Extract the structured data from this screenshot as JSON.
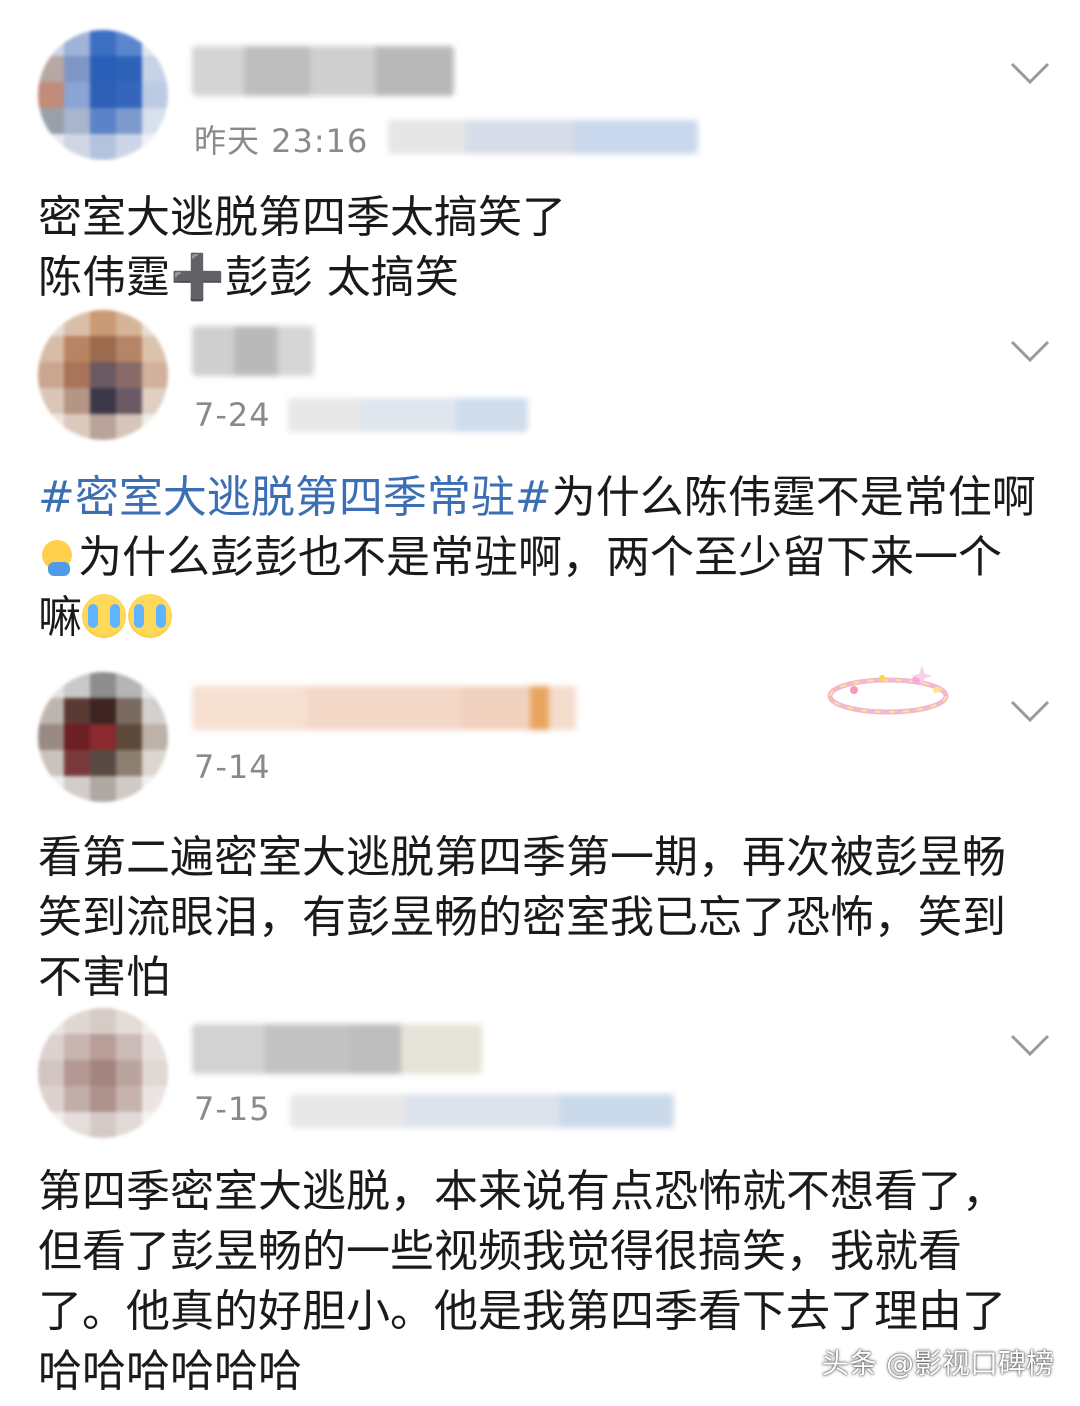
{
  "comments": [
    {
      "time": "昨天 23:16",
      "lines": [
        "密室大逃脱第四季太搞笑了",
        "陈伟霆",
        "彭彭 太搞笑"
      ],
      "plus_glyph": "➕"
    },
    {
      "time": "7-24",
      "hashtag": "#密室大逃脱第四季常驻#",
      "line1_rest": "为什么陈伟霆不是常住啊",
      "line2": "为什么彭彭也不是常驻啊，两个至少留下来一个",
      "line3": "嘛"
    },
    {
      "time": "7-14",
      "lines": [
        "看第二遍密室大逃脱第四季第一期，再次被彭昱畅",
        "笑到流眼泪，有彭昱畅的密室我已忘了恐怖，笑到",
        "不害怕"
      ]
    },
    {
      "time": "7-15",
      "lines": [
        "第四季密室大逃脱，本来说有点恐怖就不想看了，",
        "但看了彭昱畅的一些视频我觉得很搞笑，我就看",
        "了。他真的好胆小。他是我第四季看下去了理由了",
        "哈哈哈哈哈哈"
      ]
    }
  ],
  "watermark": "头条 @影视口碑榜",
  "icons": {
    "expand": "chevron-down-icon",
    "emoji_cry": "loudly-crying-face-icon",
    "emoji_wave": "waving-person-icon",
    "sticker": "sparkle-sticker-icon"
  },
  "colors": {
    "hashtag": "#3c6eb4",
    "timestamp": "#8a8a8a",
    "text": "#1a1a1a"
  }
}
